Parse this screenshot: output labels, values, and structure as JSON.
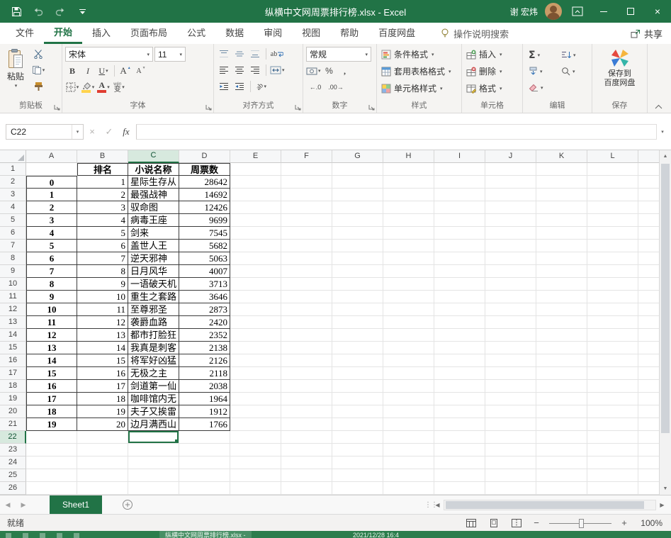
{
  "titlebar": {
    "title": "纵横中文网周票排行榜.xlsx - Excel",
    "user_name": "谢 宏炜"
  },
  "ribbon_tabs": {
    "items": [
      {
        "id": "file",
        "label": "文件",
        "active": false
      },
      {
        "id": "home",
        "label": "开始",
        "active": true
      },
      {
        "id": "insert",
        "label": "插入",
        "active": false
      },
      {
        "id": "page-layout",
        "label": "页面布局",
        "active": false
      },
      {
        "id": "formulas",
        "label": "公式",
        "active": false
      },
      {
        "id": "data",
        "label": "数据",
        "active": false
      },
      {
        "id": "review",
        "label": "审阅",
        "active": false
      },
      {
        "id": "view",
        "label": "视图",
        "active": false
      },
      {
        "id": "help",
        "label": "帮助",
        "active": false
      },
      {
        "id": "baidu-netdisk",
        "label": "百度网盘",
        "active": false
      }
    ],
    "search_label": "操作说明搜索",
    "share_label": "共享"
  },
  "ribbon": {
    "clipboard": {
      "group_label": "剪贴板",
      "paste_label": "粘贴"
    },
    "font": {
      "group_label": "字体",
      "font_name": "宋体",
      "font_size": "11",
      "bold_label": "B",
      "italic_label": "I",
      "underline_label": "U",
      "grow_font_label": "A",
      "shrink_font_label": "A",
      "font_color_label": "A",
      "phonetic_label": "变",
      "phonetic_ruby": "wén"
    },
    "alignment": {
      "group_label": "对齐方式",
      "wrap_label": "ab",
      "orientation_label": "ab"
    },
    "number": {
      "group_label": "数字",
      "format_name": "常规",
      "percent_label": "%",
      "comma_label": ",",
      "increase_decimal_label": "←.0",
      "decrease_decimal_label": ".00→"
    },
    "styles": {
      "group_label": "样式",
      "items": [
        {
          "id": "conditional-formatting",
          "label": "条件格式"
        },
        {
          "id": "format-as-table",
          "label": "套用表格格式"
        },
        {
          "id": "cell-styles",
          "label": "单元格样式"
        }
      ]
    },
    "cells": {
      "group_label": "单元格",
      "items": [
        {
          "id": "insert",
          "label": "插入"
        },
        {
          "id": "delete",
          "label": "删除"
        },
        {
          "id": "format",
          "label": "格式"
        }
      ]
    },
    "editing": {
      "group_label": "编辑",
      "autosum_label": "Σ"
    },
    "save": {
      "group_label": "保存",
      "button_line1": "保存到",
      "button_line2": "百度网盘"
    }
  },
  "formula_bar": {
    "name_box": "C22",
    "fx_label": "fx",
    "formula_value": ""
  },
  "sheet": {
    "columns": [
      "A",
      "B",
      "C",
      "D",
      "E",
      "F",
      "G",
      "H",
      "I",
      "J",
      "K",
      "L"
    ],
    "visible_rows": 26,
    "selected_c ell_note": "",
    "selected_cell": {
      "column": "C",
      "row": 22
    },
    "table": {
      "header_row": [
        "排名",
        "小说名称",
        "周票数"
      ],
      "row_format": [
        "A:index",
        "B:rank",
        "C:title",
        "D:weekly_votes"
      ],
      "rows": [
        [
          "0",
          "1",
          "星际生存从",
          "28642"
        ],
        [
          "1",
          "2",
          "最强战神",
          "14692"
        ],
        [
          "2",
          "3",
          "驭命图",
          "12426"
        ],
        [
          "3",
          "4",
          "病毒王座",
          "9699"
        ],
        [
          "4",
          "5",
          "剑来",
          "7545"
        ],
        [
          "5",
          "6",
          "盖世人王",
          "5682"
        ],
        [
          "6",
          "7",
          "逆天邪神",
          "5063"
        ],
        [
          "7",
          "8",
          "日月风华",
          "4007"
        ],
        [
          "8",
          "9",
          "一语破天机",
          "3713"
        ],
        [
          "9",
          "10",
          "重生之套路",
          "3646"
        ],
        [
          "10",
          "11",
          "至尊邪圣",
          "2873"
        ],
        [
          "11",
          "12",
          "袭爵血路",
          "2420"
        ],
        [
          "12",
          "13",
          "都市打脸狂",
          "2352"
        ],
        [
          "13",
          "14",
          "我真是刺客",
          "2138"
        ],
        [
          "14",
          "15",
          "将军好凶猛",
          "2126"
        ],
        [
          "15",
          "16",
          "无极之主",
          "2118"
        ],
        [
          "16",
          "17",
          "剑道第一仙",
          "2038"
        ],
        [
          "17",
          "18",
          "咖啡馆内无",
          "1964"
        ],
        [
          "18",
          "19",
          "夫子又挨雷",
          "1912"
        ],
        [
          "19",
          "20",
          "边月满西山",
          "1766"
        ]
      ]
    }
  },
  "sheet_tabs": {
    "tabs": [
      "Sheet1"
    ]
  },
  "status_bar": {
    "status": "就绪",
    "zoom": "100%"
  },
  "taskbar": {
    "app_fragment": "纵横中文网周票排行榜.xlsx - ",
    "time_fragment": "2021/12/28 16:4"
  },
  "colors": {
    "excel_green": "#217346",
    "fill_yellow": "#ffd34d",
    "font_red": "#e03c31"
  }
}
